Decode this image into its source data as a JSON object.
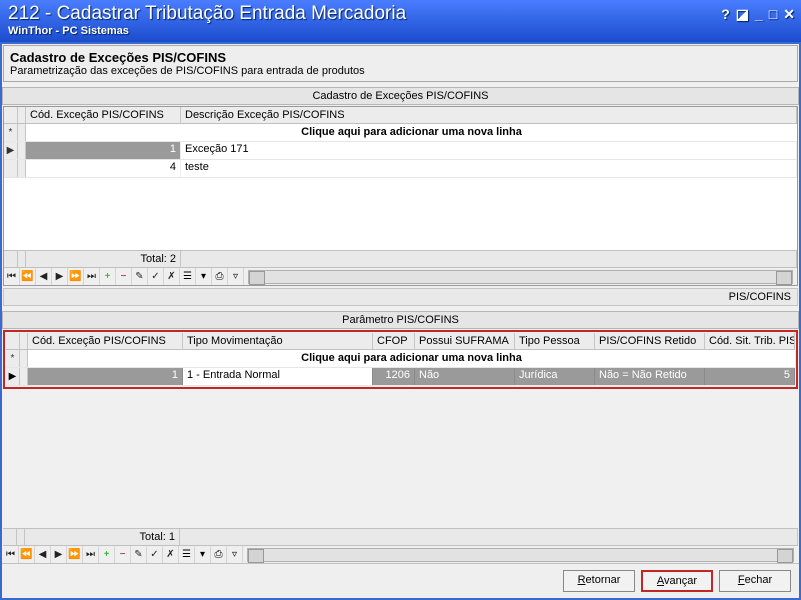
{
  "titlebar": {
    "title": "212 - Cadastrar Tributação Entrada Mercadoria",
    "subtitle": "WinThor - PC Sistemas"
  },
  "registration": {
    "heading": "Cadastro de Exceções PIS/COFINS",
    "subheading": "Parametrização das exceções de PIS/COFINS para entrada de produtos"
  },
  "grid1": {
    "section_label": "Cadastro de Exceções PIS/COFINS",
    "col_code": "Cód. Exceção PIS/COFINS",
    "col_desc": "Descrição Exceção PIS/COFINS",
    "new_row_hint": "Clique aqui para adicionar uma nova linha",
    "rows": [
      {
        "code": "1",
        "desc": "Exceção 171"
      },
      {
        "code": "4",
        "desc": "teste"
      }
    ],
    "total_label": "Total: 2"
  },
  "grid2": {
    "section_label_right": "PIS/COFINS",
    "section_label": "Parâmetro PIS/COFINS",
    "col_code": "Cód. Exceção PIS/COFINS",
    "col_tipo_mov": "Tipo Movimentação",
    "col_cfop": "CFOP",
    "col_suframa": "Possui SUFRAMA",
    "col_tipo_pessoa": "Tipo Pessoa",
    "col_pis_retido": "PIS/COFINS Retido",
    "col_cst": "Cód. Sit. Trib. PIS/CO",
    "new_row_hint": "Clique aqui para adicionar uma nova linha",
    "row": {
      "code": "1",
      "tipo_mov": "1 - Entrada Normal",
      "cfop": "1206",
      "suframa": "Não",
      "tipo_pessoa": "Jurídica",
      "retido": "Não = Não Retido",
      "cst": "5"
    },
    "total_label": "Total: 1"
  },
  "buttons": {
    "retornar": "Retornar",
    "avancar": "Avançar",
    "fechar": "Fechar"
  }
}
